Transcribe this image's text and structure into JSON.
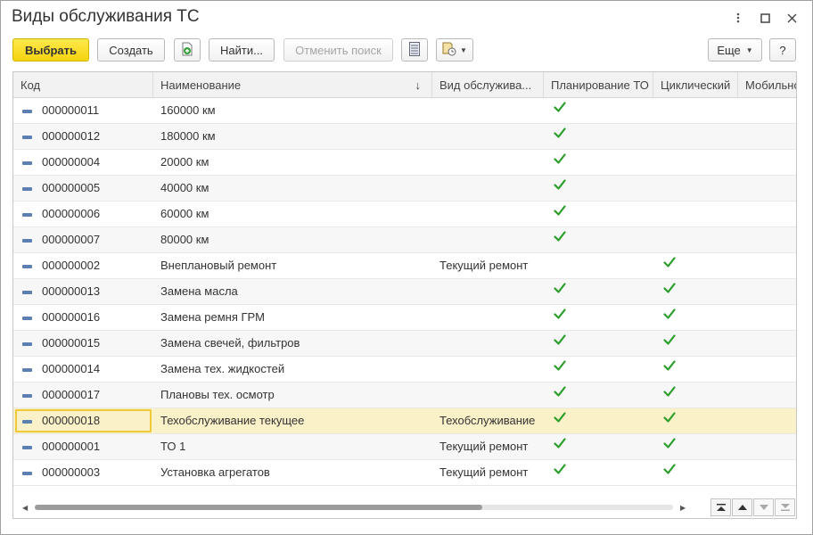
{
  "window": {
    "title": "Виды обслуживания ТС"
  },
  "window_controls": [
    "more-icon",
    "maximize-icon",
    "close-icon"
  ],
  "toolbar": {
    "select_label": "Выбрать",
    "create_label": "Создать",
    "find_label": "Найти...",
    "cancel_search_label": "Отменить поиск",
    "more_label": "Еще",
    "help_label": "?"
  },
  "colors": {
    "primary": "#f4d30f",
    "check": "#2a9d2a",
    "selected_row": "#fbf1c8",
    "row_icon": "#5a7fb0"
  },
  "table": {
    "columns": [
      "Код",
      "Наименование",
      "Вид обслужива...",
      "Планирование ТО",
      "Циклический",
      "Мобильно"
    ],
    "sort_indicator": "↓",
    "rows": [
      {
        "code": "000000011",
        "name": "160000 км",
        "type": "",
        "plan": true,
        "cyclic": false
      },
      {
        "code": "000000012",
        "name": "180000 км",
        "type": "",
        "plan": true,
        "cyclic": false
      },
      {
        "code": "000000004",
        "name": "20000 км",
        "type": "",
        "plan": true,
        "cyclic": false
      },
      {
        "code": "000000005",
        "name": "40000 км",
        "type": "",
        "plan": true,
        "cyclic": false
      },
      {
        "code": "000000006",
        "name": "60000 км",
        "type": "",
        "plan": true,
        "cyclic": false
      },
      {
        "code": "000000007",
        "name": "80000 км",
        "type": "",
        "plan": true,
        "cyclic": false
      },
      {
        "code": "000000002",
        "name": "Внеплановый ремонт",
        "type": "Текущий ремонт",
        "plan": false,
        "cyclic": true
      },
      {
        "code": "000000013",
        "name": "Замена масла",
        "type": "",
        "plan": true,
        "cyclic": true
      },
      {
        "code": "000000016",
        "name": "Замена ремня ГРМ",
        "type": "",
        "plan": true,
        "cyclic": true
      },
      {
        "code": "000000015",
        "name": "Замена свечей, фильтров",
        "type": "",
        "plan": true,
        "cyclic": true
      },
      {
        "code": "000000014",
        "name": "Замена тех. жидкостей",
        "type": "",
        "plan": true,
        "cyclic": true
      },
      {
        "code": "000000017",
        "name": "Плановы тех. осмотр",
        "type": "",
        "plan": true,
        "cyclic": true
      },
      {
        "code": "000000018",
        "name": "Техобслуживание текущее",
        "type": "Техобслуживание",
        "plan": true,
        "cyclic": true,
        "selected": true
      },
      {
        "code": "000000001",
        "name": "ТО 1",
        "type": "Текущий ремонт",
        "plan": true,
        "cyclic": true
      },
      {
        "code": "000000003",
        "name": "Установка агрегатов",
        "type": "Текущий ремонт",
        "plan": true,
        "cyclic": true
      }
    ]
  }
}
